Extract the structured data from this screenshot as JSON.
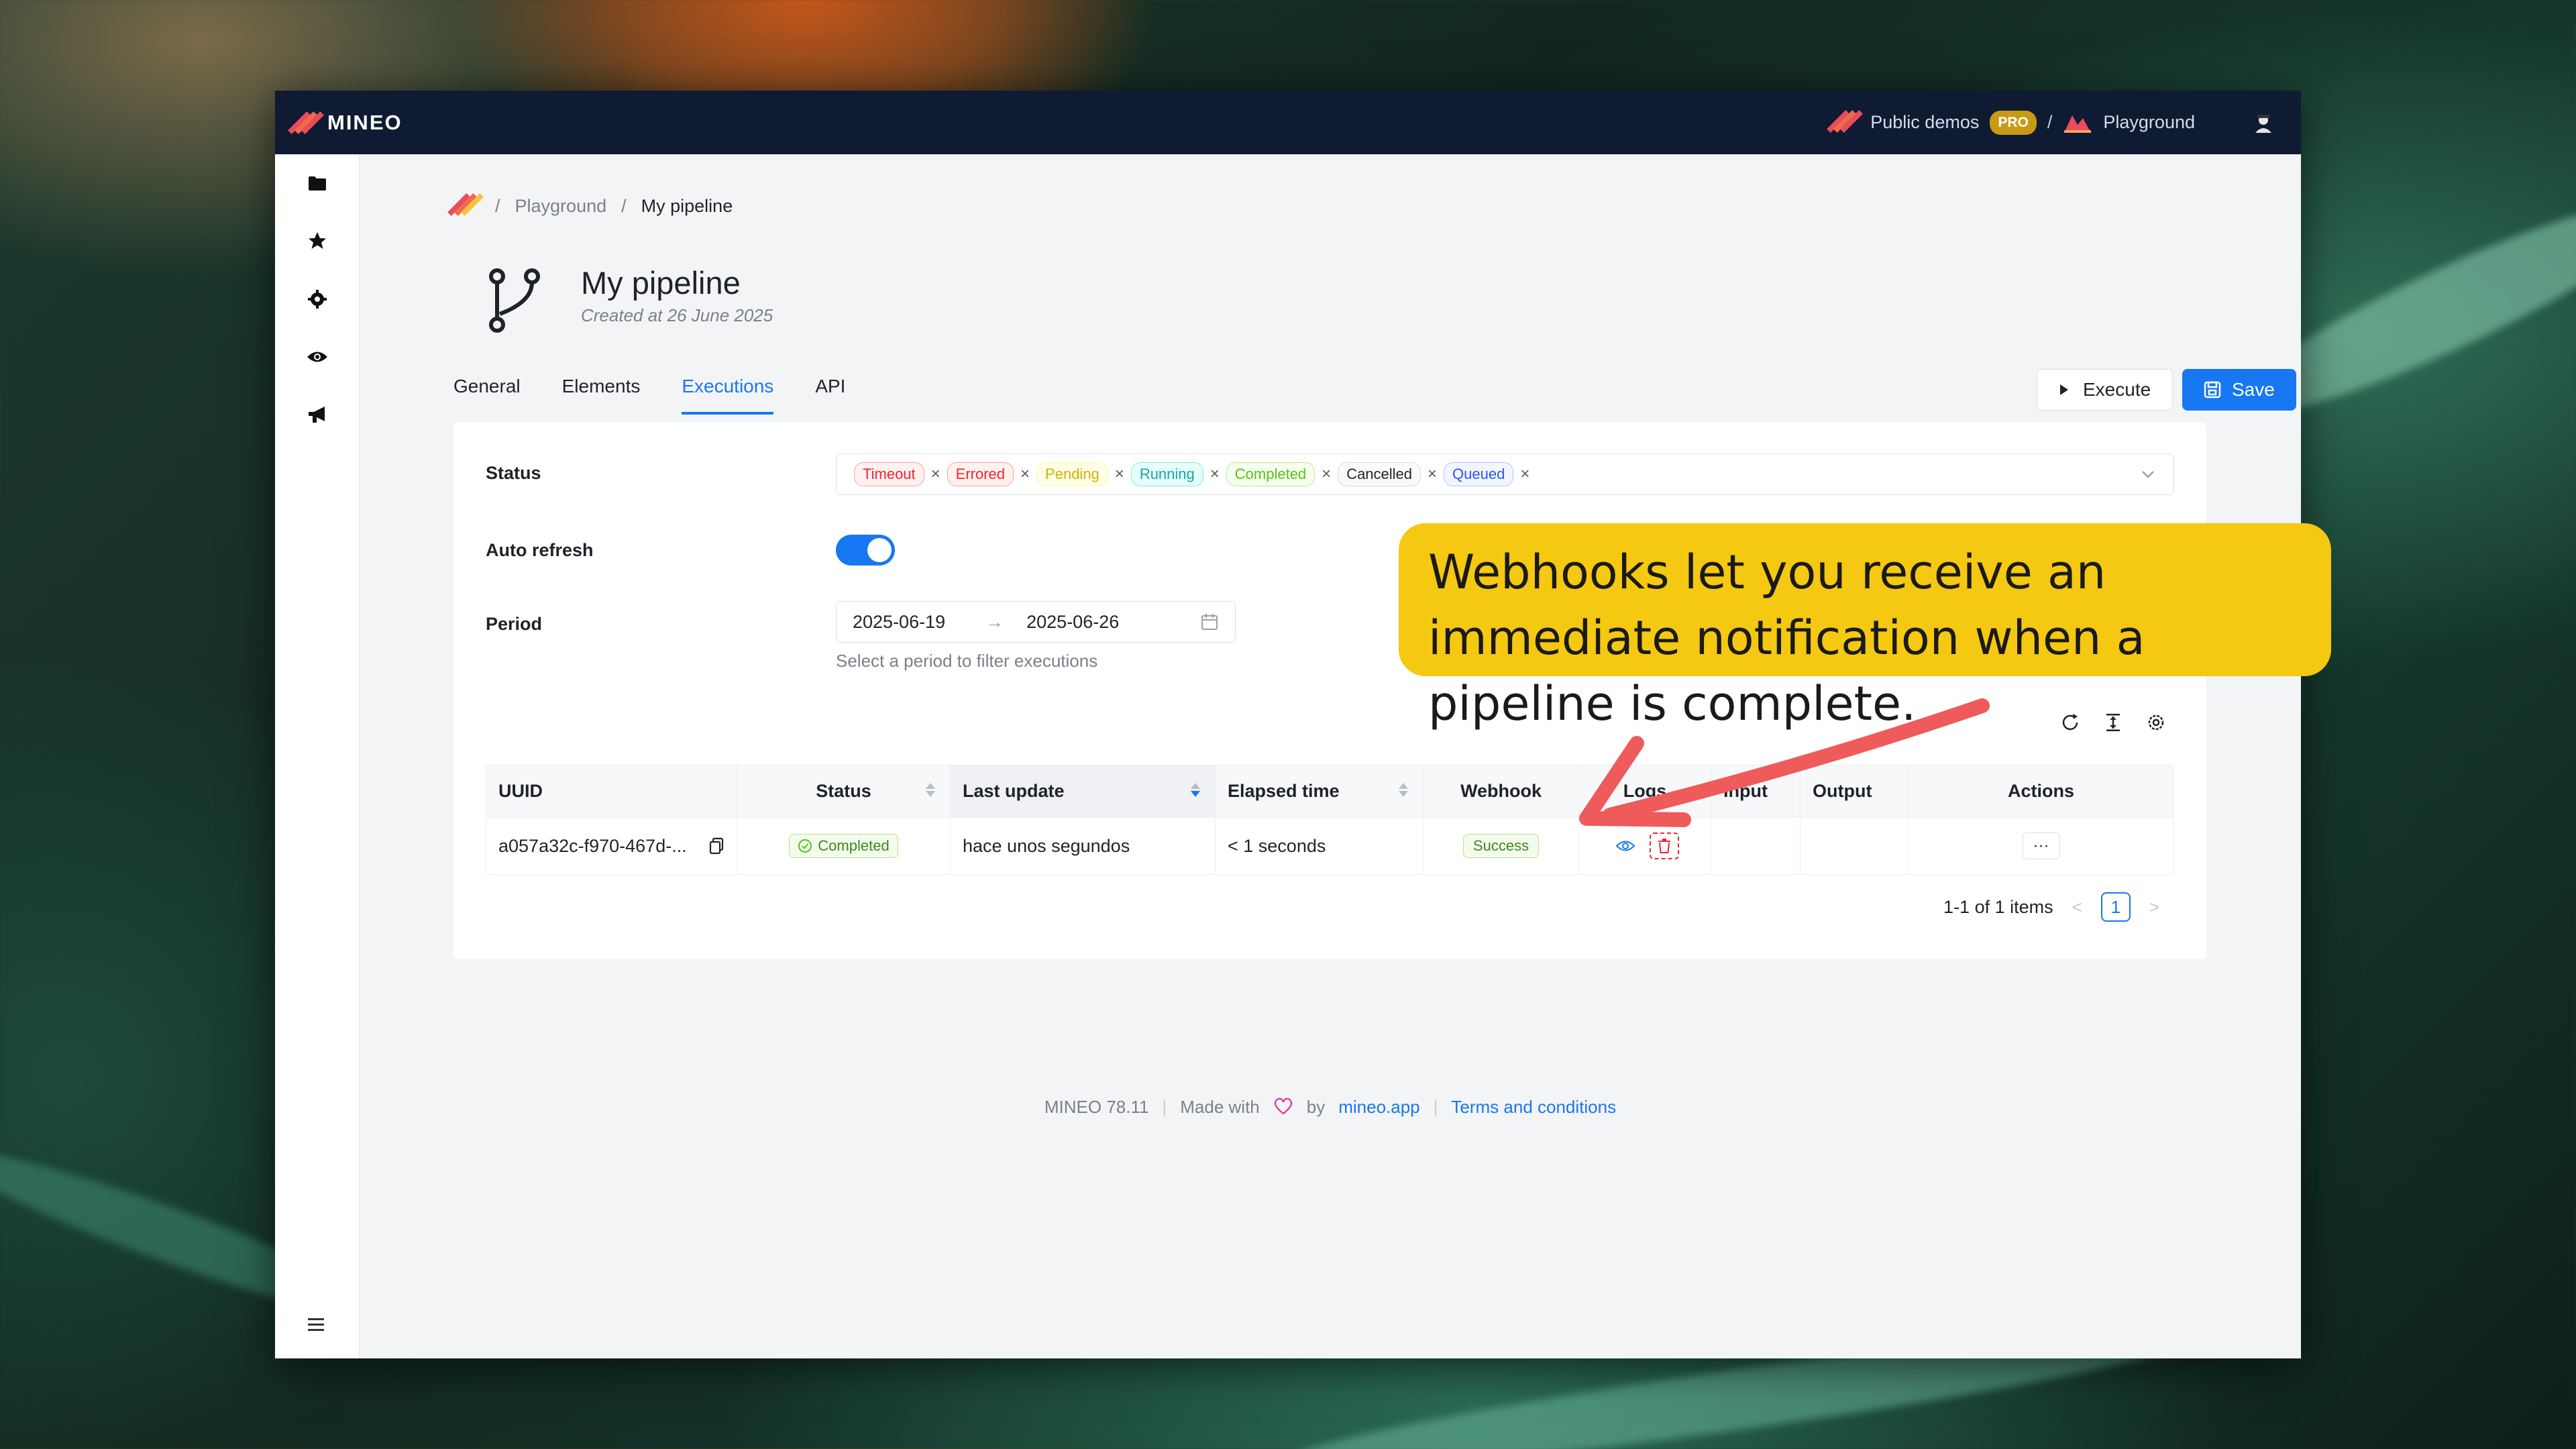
{
  "topbar": {
    "logo_text": "MINEO",
    "org_name": "Public demos",
    "org_badge": "PRO",
    "separator": "/",
    "project_name": "Playground"
  },
  "sidebar": {
    "items": [
      {
        "icon": "folder-icon"
      },
      {
        "icon": "star-icon"
      },
      {
        "icon": "gear-icon"
      },
      {
        "icon": "eye-icon"
      },
      {
        "icon": "megaphone-icon"
      }
    ],
    "menu_icon": "menu-icon"
  },
  "breadcrumb": {
    "items": [
      "Playground",
      "My pipeline"
    ],
    "separator": "/"
  },
  "page": {
    "title": "My pipeline",
    "subtitle": "Created at 26 June 2025"
  },
  "tabs": [
    "General",
    "Elements",
    "Executions",
    "API"
  ],
  "active_tab": "Executions",
  "actions": {
    "execute_label": "Execute",
    "save_label": "Save"
  },
  "filters": {
    "status_label": "Status",
    "status_tags": [
      {
        "label": "Timeout",
        "color": "#f5222d",
        "bg": "#fff1f0",
        "border": "#ffa39e"
      },
      {
        "label": "Errored",
        "color": "#f5222d",
        "bg": "#fff1f0",
        "border": "#ffa39e"
      },
      {
        "label": "Pending",
        "color": "#d4b106",
        "bg": "#feffe6",
        "border": "#fffb8f"
      },
      {
        "label": "Running",
        "color": "#13a8a8",
        "bg": "#e6fffb",
        "border": "#87e8de"
      },
      {
        "label": "Completed",
        "color": "#52c41a",
        "bg": "#f6ffed",
        "border": "#b7eb8f"
      },
      {
        "label": "Cancelled",
        "color": "#1f2329",
        "bg": "#fafafa",
        "border": "#d9d9d9"
      },
      {
        "label": "Queued",
        "color": "#2f54eb",
        "bg": "#f0f5ff",
        "border": "#adc6ff"
      }
    ],
    "auto_refresh_label": "Auto refresh",
    "auto_refresh_on": true,
    "period_label": "Period",
    "period_start": "2025-06-19",
    "period_arrow": "→",
    "period_end": "2025-06-26",
    "period_help": "Select a period to filter executions"
  },
  "table": {
    "columns": [
      "UUID",
      "Status",
      "Last update",
      "Elapsed time",
      "Webhook",
      "Logs",
      "Input",
      "Output",
      "Actions"
    ],
    "rows": [
      {
        "uuid": "a057a32c-f970-467d-...",
        "status": "Completed",
        "last_update": "hace unos segundos",
        "elapsed": "< 1 seconds",
        "webhook": "Success",
        "actions": "···"
      }
    ]
  },
  "pagination": {
    "summary": "1-1 of 1 items",
    "prev": "<",
    "current": "1",
    "next": ">"
  },
  "footer": {
    "version": "MINEO 78.11",
    "made_with": "Made with",
    "by": "by",
    "site": "mineo.app",
    "terms": "Terms and conditions",
    "bar": "|"
  },
  "callout": {
    "text": "Webhooks let you receive an immediate notification when a pipeline is complete."
  },
  "colors": {
    "accent": "#1877f2",
    "topbar": "#0e1b33",
    "callout": "#f5c811",
    "arrow": "#ef5a5a"
  }
}
